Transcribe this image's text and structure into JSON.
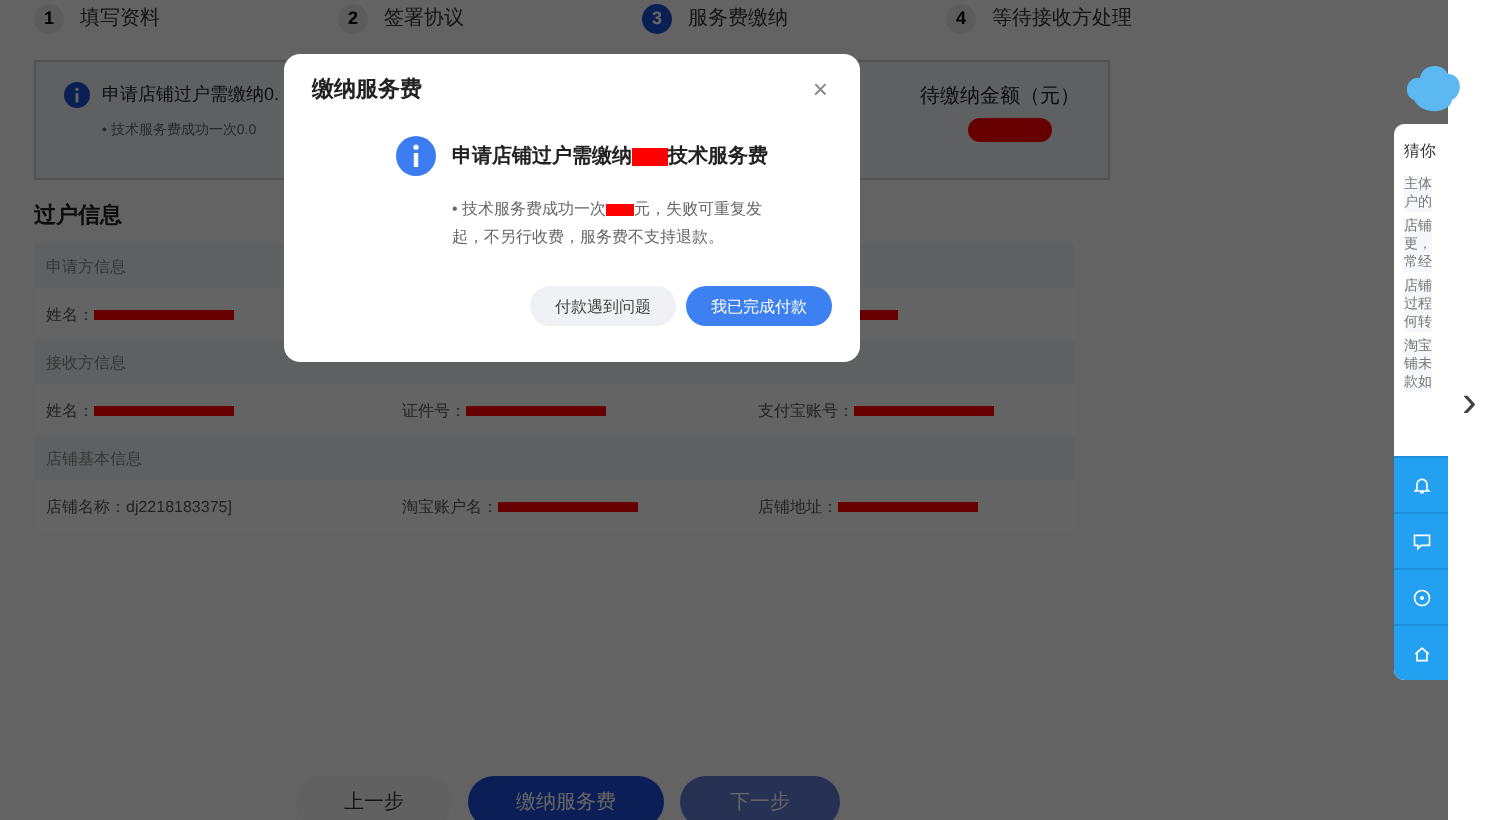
{
  "steps": [
    {
      "number": "1",
      "label": "填写资料",
      "selected": false
    },
    {
      "number": "2",
      "label": "签署协议",
      "selected": false
    },
    {
      "number": "3",
      "label": "服务费缴纳",
      "selected": true
    },
    {
      "number": "4",
      "label": "等待接收方处理",
      "selected": false
    }
  ],
  "notice": {
    "title": "申请店铺过户需缴纳0.",
    "note": "• 技术服务费成功一次0.0",
    "amount_label": "待缴纳金额（元）",
    "amount_redacted": true
  },
  "section_title": "过户信息",
  "sections": [
    {
      "title": "申请方信息",
      "fields": [
        {
          "label": "姓名：",
          "redacted": true
        },
        {
          "redacted": true
        }
      ]
    },
    {
      "title": "接收方信息",
      "fields": [
        {
          "label": "姓名：",
          "redacted": true
        },
        {
          "label": "证件号：",
          "redacted": true
        },
        {
          "label": "支付宝账号：",
          "redacted": true
        }
      ]
    },
    {
      "title": "店铺基本信息",
      "fields": [
        {
          "label": "店铺名称：",
          "value": "dj2218183375]",
          "redacted": false
        },
        {
          "label": "淘宝账户名：",
          "redacted": true
        },
        {
          "label": "店铺地址：",
          "redacted": true
        }
      ]
    }
  ],
  "footer_buttons": [
    {
      "label": "上一步",
      "kind": "plain"
    },
    {
      "label": "缴纳服务费",
      "kind": "primary"
    },
    {
      "label": "下一步",
      "kind": "disabled"
    }
  ],
  "modal": {
    "title": "缴纳服务费",
    "close": "×",
    "heading": [
      {
        "kind": "text",
        "text": "申请店铺过户需缴纳"
      },
      {
        "kind": "redaction"
      },
      {
        "kind": "text",
        "text": "技术服务费"
      }
    ],
    "note": [
      {
        "kind": "text",
        "text": "• 技术服务费成功一次"
      },
      {
        "kind": "redaction"
      },
      {
        "kind": "text",
        "text": "元，失败可重复发"
      },
      {
        "kind": "break"
      },
      {
        "kind": "text",
        "text": "起，不另行收费，服务费不支持退款。"
      }
    ],
    "buttons": [
      {
        "label": "付款遇到问题",
        "kind": "plain"
      },
      {
        "label": "我已完成付款",
        "kind": "primary"
      }
    ]
  },
  "helper": {
    "title": "猜你",
    "items": [
      "主体户的",
      "店铺更，常经",
      "店铺过程何转",
      "淘宝铺未款如"
    ]
  },
  "side_arrow": "›"
}
